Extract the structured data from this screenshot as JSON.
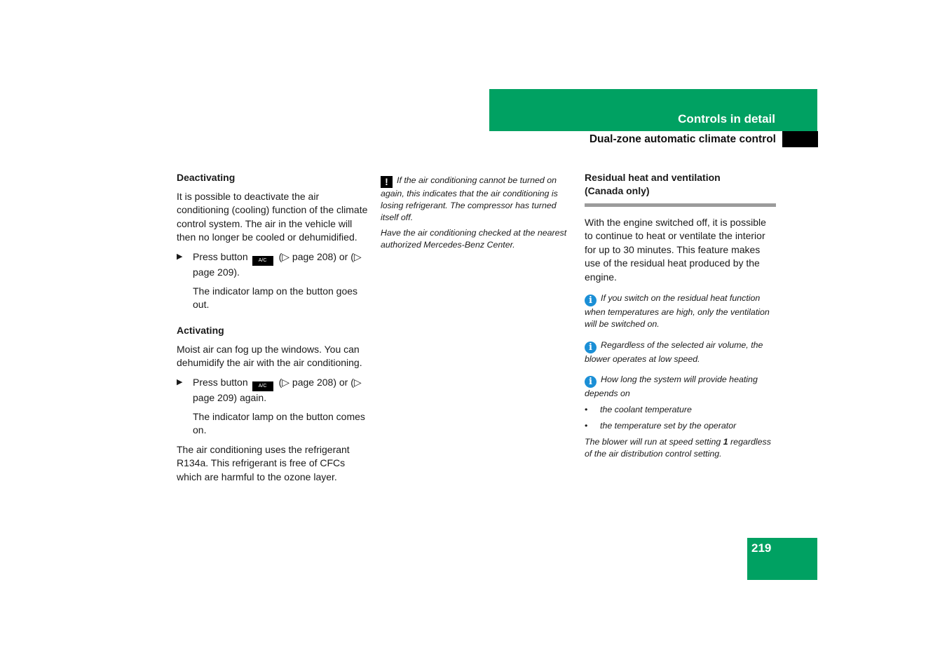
{
  "header": {
    "section": "Controls in detail",
    "subsection": "Dual-zone automatic climate control"
  },
  "page_number": "219",
  "left": {
    "deactivating": {
      "heading": "Deactivating",
      "intro": "It is possible to deactivate the air conditioning (cooling) function of the climate control system. The air in the vehicle will then no longer be cooled or dehumidified.",
      "step_prefix": "Press button",
      "button_label": "A/C",
      "step_suffix": "(▷ page 208) or (▷ page 209).",
      "result": "The indicator lamp on the button goes out."
    },
    "activating": {
      "heading": "Activating",
      "intro": "Moist air can fog up the windows. You can dehumidify the air with the air conditioning.",
      "step_prefix": "Press button",
      "button_label": "A/C",
      "step_suffix": "(▷ page 208) or (▷ page 209) again.",
      "result": "The indicator lamp on the button comes on."
    },
    "refrigerant_note": "The air conditioning uses the refrigerant R134a. This refrigerant is free of CFCs which are harmful to the ozone layer."
  },
  "middle": {
    "warning_icon": "!",
    "warning_text": "If the air conditioning cannot be turned on again, this indicates that the air conditioning is losing refrigerant. The compressor has turned itself off.",
    "warning_followup": "Have the air conditioning checked at the nearest authorized Mercedes-Benz Center."
  },
  "right": {
    "heading": "Residual heat and ventilation (Canada only)",
    "intro": "With the engine switched off, it is possible to continue to heat or ventilate the interior for up to 30 minutes. This feature makes use of the residual heat produced by the engine.",
    "info_icon": "i",
    "notes": [
      "If you switch on the residual heat function when temperatures are high, only the ventilation will be switched on.",
      "Regardless of the selected air volume, the blower operates at low speed.",
      "How long the system will provide heating depends on"
    ],
    "bullet_char": "•",
    "bullets": [
      "the coolant temperature",
      "the temperature set by the operator"
    ],
    "closing_prefix": "The blower will run at speed setting",
    "closing_bold": "1",
    "closing_suffix": "regardless of the air distribution control setting."
  },
  "step_arrow": "▶",
  "colors": {
    "brand_green": "#00a162",
    "info_blue": "#1b8fd6"
  }
}
